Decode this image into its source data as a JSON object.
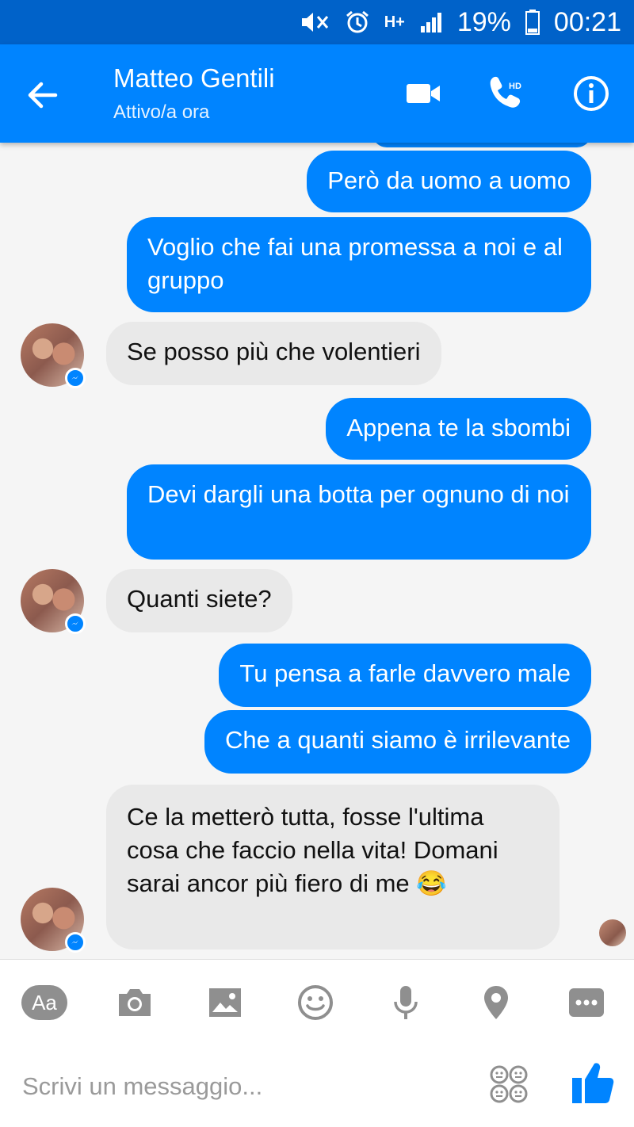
{
  "status_bar": {
    "network": "H+",
    "battery": "19%",
    "time": "00:21"
  },
  "header": {
    "contact_name": "Matteo Gentili",
    "status": "Attivo/a ora"
  },
  "messages": [
    {
      "dir": "out",
      "text": "Però da uomo a uomo"
    },
    {
      "dir": "out",
      "text": "Voglio che fai una promessa a noi e al gruppo"
    },
    {
      "dir": "in",
      "text": "Se posso più che volentieri"
    },
    {
      "dir": "out",
      "text": "Appena te la sbombi"
    },
    {
      "dir": "out",
      "text": "Devi dargli una botta per ognuno di noi"
    },
    {
      "dir": "in",
      "text": "Quanti siete?"
    },
    {
      "dir": "out",
      "text": "Tu pensa a farle davvero male"
    },
    {
      "dir": "out",
      "text": "Che a quanti siamo è irrilevante"
    },
    {
      "dir": "in",
      "text": "Ce la metterò tutta, fosse l'ultima cosa che faccio nella vita! Domani sarai ancor più fiero di me 😂"
    }
  ],
  "toolbar": {
    "text_button_label": "Aa"
  },
  "composer": {
    "placeholder": "Scrivi un messaggio..."
  },
  "colors": {
    "header": "#0084ff",
    "status_bar": "#0062c9",
    "outgoing_bubble": "#0084ff",
    "incoming_bubble": "#e9e9e9"
  }
}
